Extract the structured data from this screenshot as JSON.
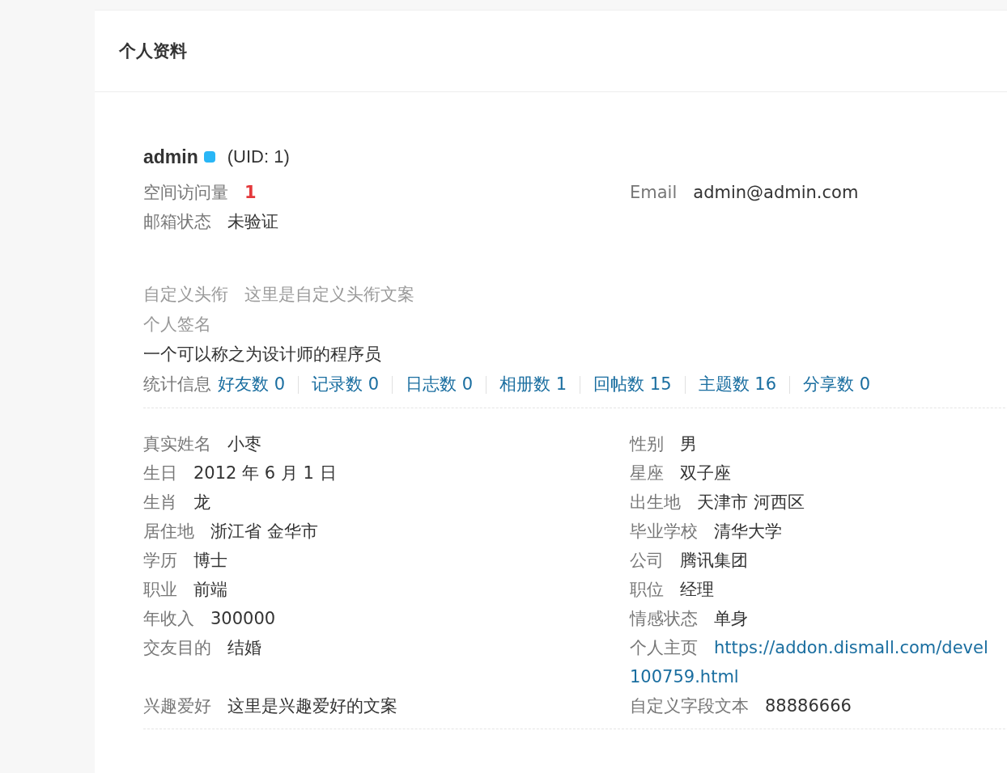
{
  "header": {
    "title": "个人资料"
  },
  "user": {
    "name": "admin",
    "uid": "(UID: 1)"
  },
  "basic": {
    "left": [
      {
        "label": "空间访问量",
        "value": "1",
        "kind": "count"
      },
      {
        "label": "邮箱状态",
        "value": "未验证",
        "kind": "text"
      }
    ],
    "right": [
      {
        "label": "Email",
        "value": "admin@admin.com",
        "kind": "text"
      }
    ]
  },
  "custom_title": {
    "label": "自定义头衔",
    "value": "这里是自定义头衔文案"
  },
  "signature": {
    "label": "个人签名",
    "text": "一个可以称之为设计师的程序员"
  },
  "stats": {
    "label": "统计信息",
    "items": [
      "好友数 0",
      "记录数 0",
      "日志数 0",
      "相册数 1",
      "回帖数 15",
      "主题数 16",
      "分享数 0"
    ]
  },
  "profile": {
    "left": [
      {
        "label": "真实姓名",
        "value": "小枣",
        "kind": "text"
      },
      {
        "label": "生日",
        "value": "2012 年 6 月 1 日",
        "kind": "text"
      },
      {
        "label": "生肖",
        "value": "龙",
        "kind": "text"
      },
      {
        "label": "居住地",
        "value": "浙江省 金华市",
        "kind": "text"
      },
      {
        "label": "学历",
        "value": "博士",
        "kind": "text"
      },
      {
        "label": "职业",
        "value": "前端",
        "kind": "text"
      },
      {
        "label": "年收入",
        "value": "300000",
        "kind": "text"
      },
      {
        "label": "交友目的",
        "value": "结婚",
        "kind": "text"
      },
      {
        "label": "兴趣爱好",
        "value": "这里是兴趣爱好的文案",
        "kind": "text"
      }
    ],
    "right": [
      {
        "label": "性别",
        "value": "男",
        "kind": "text"
      },
      {
        "label": "星座",
        "value": "双子座",
        "kind": "text"
      },
      {
        "label": "出生地",
        "value": "天津市 河西区",
        "kind": "text"
      },
      {
        "label": "毕业学校",
        "value": "清华大学",
        "kind": "text"
      },
      {
        "label": "公司",
        "value": "腾讯集团",
        "kind": "text"
      },
      {
        "label": "职位",
        "value": "经理",
        "kind": "text"
      },
      {
        "label": "情感状态",
        "value": "单身",
        "kind": "text"
      },
      {
        "label": "个人主页",
        "lines": [
          "https://addon.dismall.com/devel",
          "100759.html"
        ],
        "kind": "link"
      },
      {
        "label": "自定义字段文本",
        "value": "88886666",
        "kind": "text"
      }
    ]
  }
}
